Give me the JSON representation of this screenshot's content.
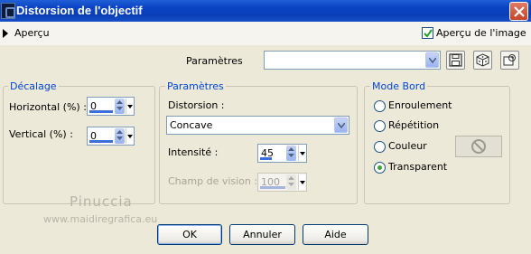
{
  "window": {
    "title": "Distorsion de l'objectif"
  },
  "preview": {
    "label": "Aperçu",
    "image_preview_label": "Aperçu de l'image",
    "image_preview_checked": true
  },
  "presets": {
    "label": "Paramètres",
    "value": ""
  },
  "decalage": {
    "title": "Décalage",
    "horizontal_label": "Horizontal (%) :",
    "horizontal_value": "0",
    "vertical_label": "Vertical (%) :",
    "vertical_value": "0"
  },
  "parametres": {
    "title": "Paramètres",
    "distorsion_label": "Distorsion :",
    "distorsion_value": "Concave",
    "intensite_label": "Intensité :",
    "intensite_value": "45",
    "champ_label": "Champ de vision :",
    "champ_value": "100"
  },
  "mode_bord": {
    "title": "Mode Bord",
    "options": [
      "Enroulement",
      "Répétition",
      "Couleur",
      "Transparent"
    ],
    "selected": "Transparent"
  },
  "watermark": {
    "line1": "Pinuccia",
    "line2": "www.maidiregrafica.eu"
  },
  "buttons": {
    "ok": "OK",
    "cancel": "Annuler",
    "help": "Aide"
  },
  "colors": {
    "titlebar": "#0a43c4",
    "group_title": "#0046d5",
    "background": "#ece9d8"
  }
}
